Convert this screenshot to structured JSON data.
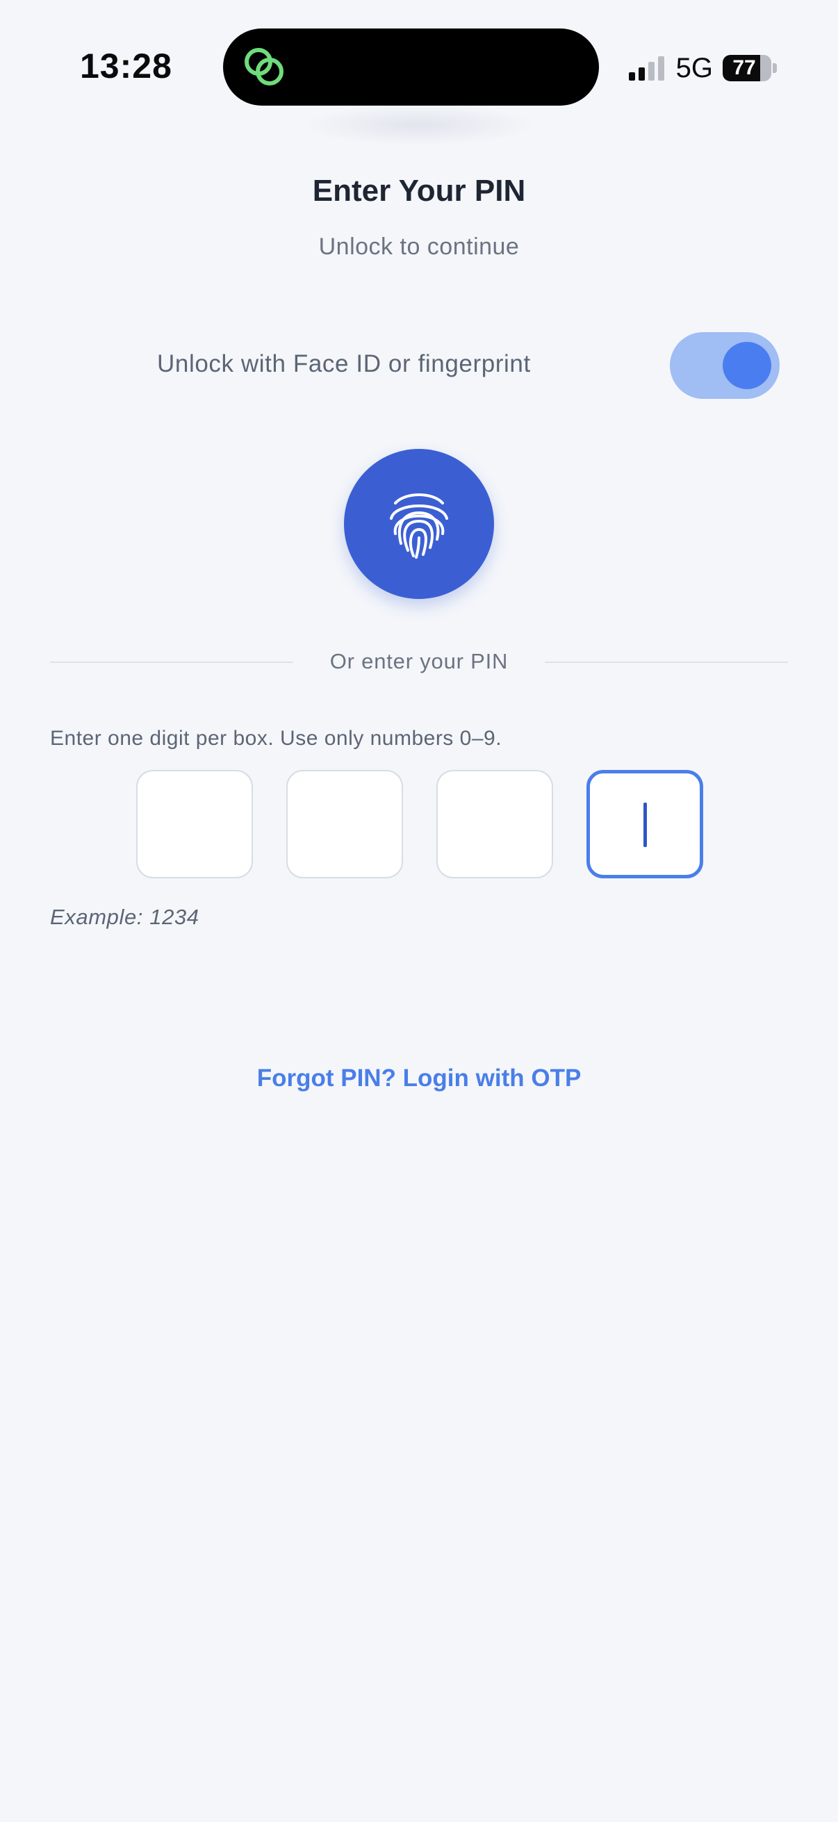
{
  "status_bar": {
    "time": "13:28",
    "network": "5G",
    "battery_percent": "77",
    "battery_level": 0.77,
    "island_app_icon": "linked-rings-icon",
    "island_icon_color": "#6fdc7c"
  },
  "header": {
    "title": "Enter Your PIN",
    "subtitle": "Unlock to continue"
  },
  "biometric": {
    "label": "Unlock with Face ID or fingerprint",
    "toggle_on": true,
    "button_icon": "fingerprint-icon"
  },
  "divider": {
    "text": "Or enter your PIN"
  },
  "pin": {
    "instructions": "Enter one digit per box. Use only numbers 0–9.",
    "digits": [
      "",
      "",
      "",
      ""
    ],
    "focused_index": 3,
    "example": "Example: 1234"
  },
  "links": {
    "forgot": "Forgot PIN? Login with OTP"
  },
  "colors": {
    "accent": "#4a7ee8",
    "fingerprint_button": "#3b5fd3",
    "toggle_track": "#a0bdf4",
    "background": "#f4f6fa"
  }
}
